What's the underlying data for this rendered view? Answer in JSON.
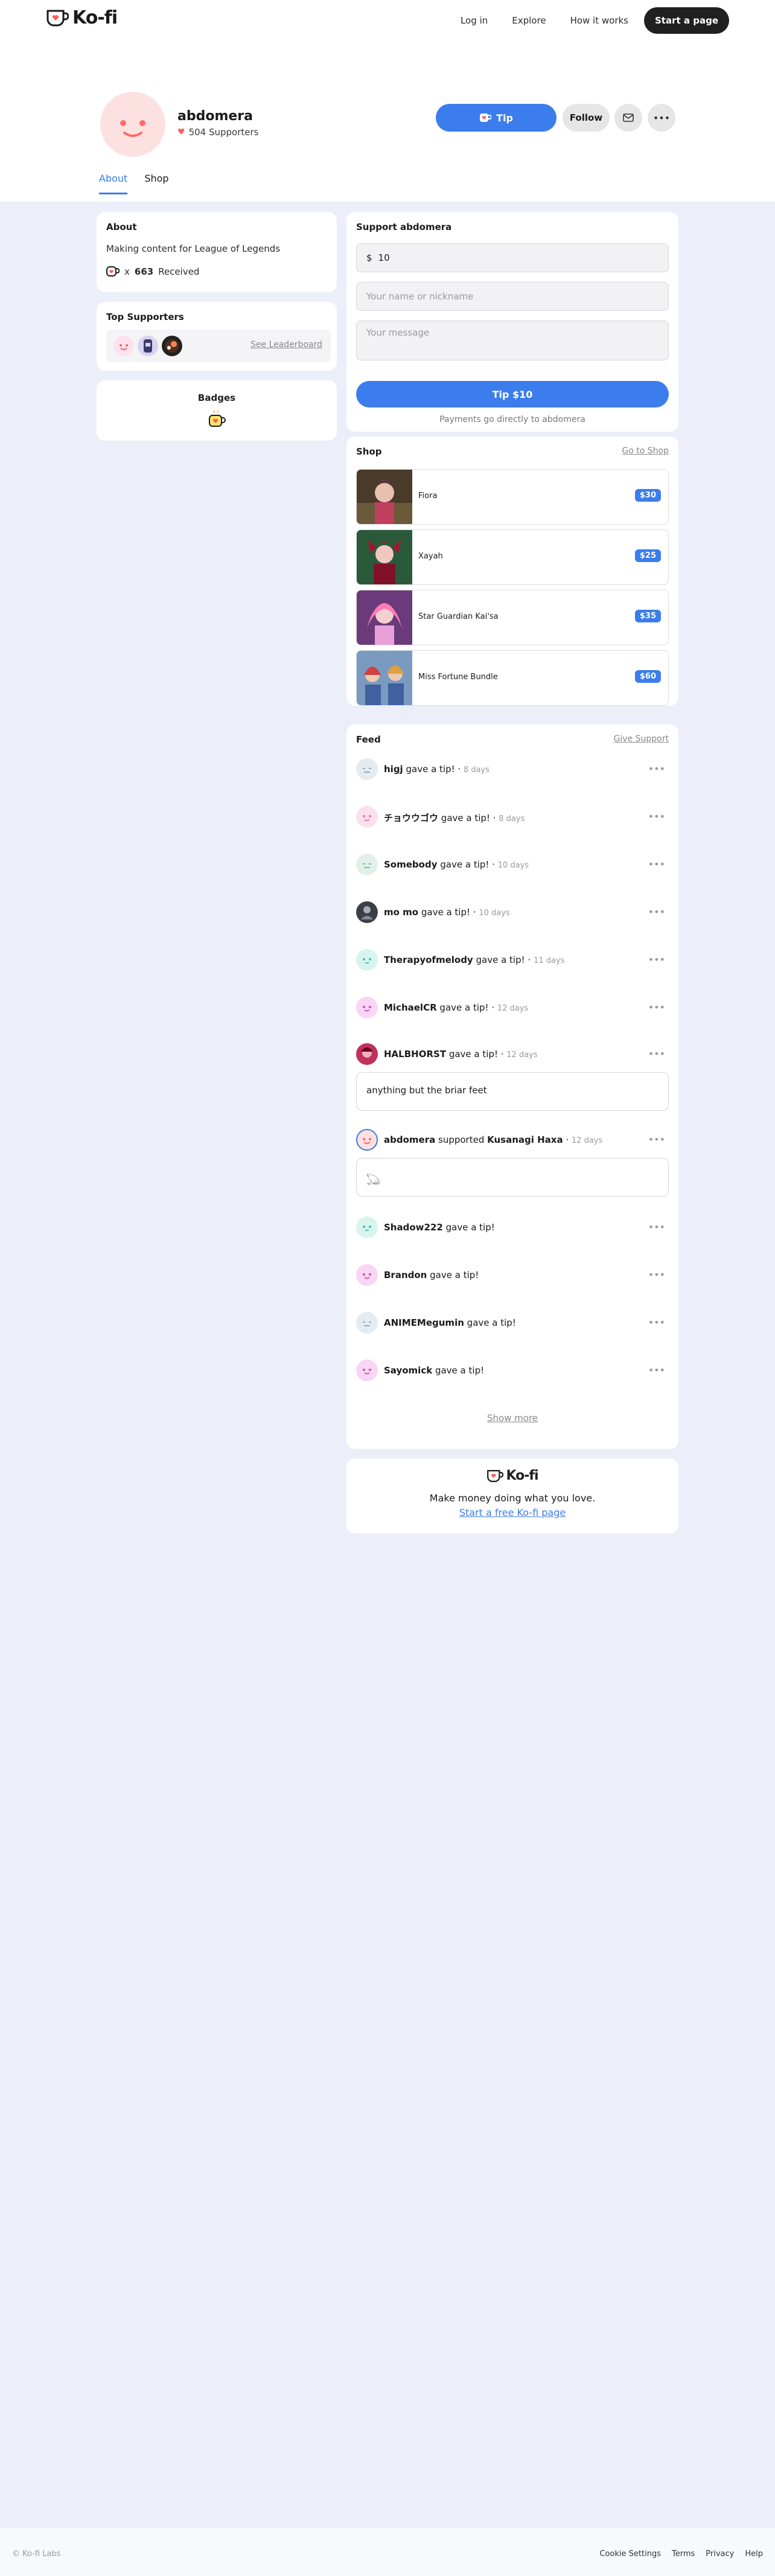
{
  "nav": {
    "logo_text": "Ko-fi",
    "links": [
      "Log in",
      "Explore",
      "How it works"
    ],
    "cta": "Start a page"
  },
  "profile": {
    "name": "abdomera",
    "supporters": "504 Supporters",
    "tip_label": "Tip",
    "follow_label": "Follow",
    "tabs": [
      "About",
      "Shop"
    ]
  },
  "about": {
    "title": "About",
    "text": "Making content for League of Legends",
    "received_prefix": "x",
    "received_count": "663",
    "received_label": "Received"
  },
  "top_supporters": {
    "title": "Top Supporters",
    "link": "See Leaderboard"
  },
  "badges": {
    "title": "Badges"
  },
  "support": {
    "title": "Support abdomera",
    "currency": "$",
    "amount": "10",
    "name_placeholder": "Your name or nickname",
    "message_placeholder": "Your message",
    "button": "Tip $10",
    "note": "Payments go directly to abdomera"
  },
  "shop": {
    "title": "Shop",
    "link": "Go to Shop",
    "items": [
      {
        "name": "Fiora",
        "price": "$30"
      },
      {
        "name": "Xayah",
        "price": "$25"
      },
      {
        "name": "Star Guardian Kai'sa",
        "price": "$35"
      },
      {
        "name": "Miss Fortune Bundle",
        "price": "$60"
      }
    ]
  },
  "feed": {
    "title": "Feed",
    "link": "Give Support",
    "items": [
      {
        "name": "higj",
        "action": "gave a tip!",
        "time": "8 days"
      },
      {
        "name": "チョウウゴウ",
        "action": "gave a tip!",
        "time": "8 days"
      },
      {
        "name": "Somebody",
        "action": "gave a tip!",
        "time": "10 days"
      },
      {
        "name": "mo mo",
        "action": "gave a tip!",
        "time": "10 days"
      },
      {
        "name": "Therapyofmelody",
        "action": "gave a tip!",
        "time": "11 days"
      },
      {
        "name": "MichaelCR",
        "action": "gave a tip!",
        "time": "12 days"
      },
      {
        "name": "HALBHORST",
        "action": "gave a tip!",
        "time": "12 days"
      },
      {
        "name": "abdomera",
        "action": "supported",
        "target": "Kusanagi Haxa",
        "time": "12 days"
      },
      {
        "name": "Shadow222",
        "action": "gave a tip!",
        "time": ""
      },
      {
        "name": "Brandon",
        "action": "gave a tip!",
        "time": ""
      },
      {
        "name": "ANIMEMegumin",
        "action": "gave a tip!",
        "time": ""
      },
      {
        "name": "Sayomick",
        "action": "gave a tip!",
        "time": ""
      }
    ],
    "messages": [
      "anything but the briar feet",
      "𓆏"
    ],
    "show_more": "Show more"
  },
  "promo": {
    "logo_text": "Ko-fi",
    "text": "Make money doing what you love.",
    "link": "Start a free Ko-fi page"
  },
  "footer": {
    "copyright": "© Ko-fi Labs",
    "links": [
      "Cookie Settings",
      "Terms",
      "Privacy",
      "Help"
    ]
  },
  "colors": {
    "accent": "#3b7ded",
    "brand_red": "#ff5e5b",
    "page_bg": "#eceff9"
  }
}
